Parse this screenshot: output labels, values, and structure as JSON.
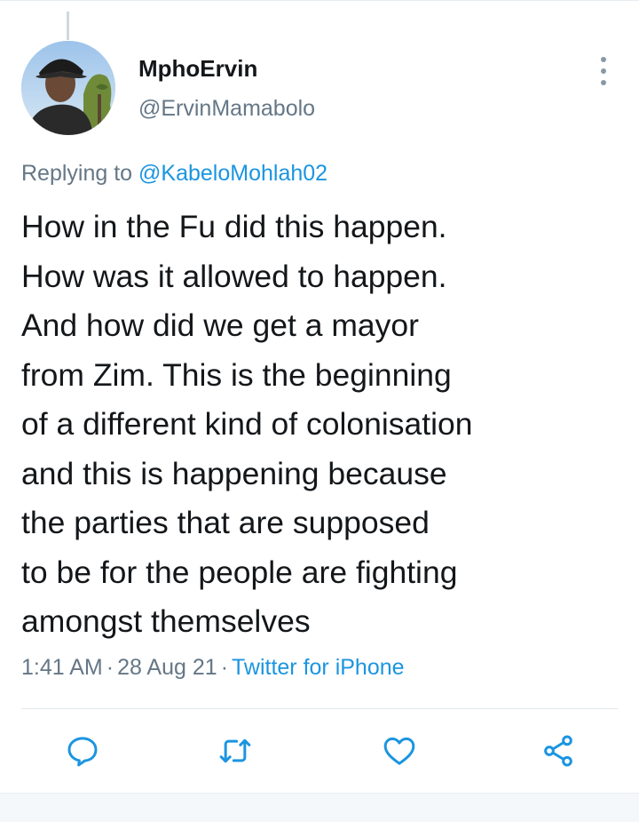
{
  "tweet": {
    "author": {
      "display_name": "MphoErvin",
      "handle": "@ErvinMamabolo",
      "avatar_icon": "profile-photo"
    },
    "reply": {
      "prefix": "Replying to",
      "mention": "@KabeloMohlah02"
    },
    "text_lines": [
      "How in the Fu did this happen.",
      "How was it allowed to happen.",
      "And how did we get a mayor",
      "from Zim. This is the beginning",
      "of a different kind of colonisation",
      "and this is happening because",
      "the parties that are supposed",
      "to be for the people are fighting",
      "amongst themselves"
    ],
    "meta": {
      "time": "1:41 AM",
      "separator": "·",
      "date": "28 Aug 21",
      "source": "Twitter for iPhone"
    },
    "actions": [
      {
        "icon": "reply-icon"
      },
      {
        "icon": "retweet-icon"
      },
      {
        "icon": "like-icon"
      },
      {
        "icon": "share-icon"
      }
    ]
  },
  "colors": {
    "text": "#14171a",
    "secondary": "#657786",
    "link": "#1b95e0",
    "icon": "#1b95e0",
    "divider": "#e1e8ed"
  }
}
